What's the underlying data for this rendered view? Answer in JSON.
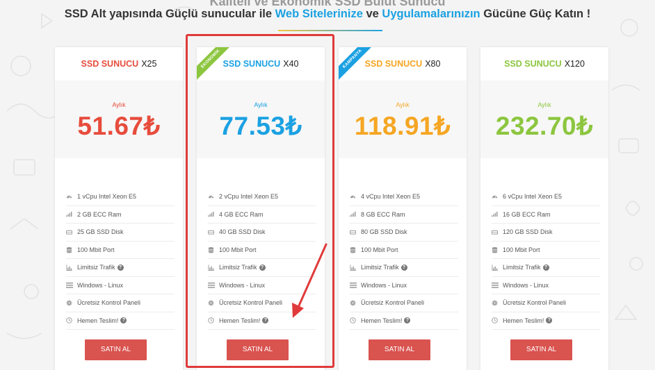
{
  "header": {
    "top_cut_text": "Kaliteli ve Ekonomik SSD Bulut Sunucu",
    "subtitle_part1": "SSD Alt yapısında Güçlü sunucular ile ",
    "subtitle_hl1": "Web Sitelerinize",
    "subtitle_part2": " ve ",
    "subtitle_hl2": "Uygulamalarınızın",
    "subtitle_part3": " Gücüne Güç Katın !"
  },
  "colors": {
    "red": "#e74c3c",
    "blue": "#1ba1e2",
    "orange": "#f5a623",
    "green": "#8cc63f",
    "button": "#d9534f",
    "highlight": "#e03a3a"
  },
  "cards": [
    {
      "brand": "SSD SUNUCU",
      "model": "X25",
      "period": "Aylık",
      "price": "51.67₺",
      "features": [
        "1 vCpu Intel Xeon E5",
        "2 GB ECC Ram",
        "25 GB SSD Disk",
        "100 Mbit Port",
        "Limitsiz Trafik",
        "Windows - Linux",
        "Ücretsiz Kontrol Paneli",
        "Hemen Teslim!"
      ],
      "button": "SATIN AL"
    },
    {
      "brand": "SSD SUNUCU",
      "model": "X40",
      "period": "Aylık",
      "price": "77.53₺",
      "ribbon": "EKONOMİK",
      "features": [
        "2 vCpu Intel Xeon E5",
        "4 GB ECC Ram",
        "40 GB SSD Disk",
        "100 Mbit Port",
        "Limitsiz Trafik",
        "Windows - Linux",
        "Ücretsiz Kontrol Paneli",
        "Hemen Teslim!"
      ],
      "button": "SATIN AL"
    },
    {
      "brand": "SSD SUNUCU",
      "model": "X80",
      "period": "Aylık",
      "price": "118.91₺",
      "ribbon": "KAMPANYA",
      "features": [
        "4 vCpu Intel Xeon E5",
        "8 GB ECC Ram",
        "80 GB SSD Disk",
        "100 Mbit Port",
        "Limitsiz Trafik",
        "Windows - Linux",
        "Ücretsiz Kontrol Paneli",
        "Hemen Teslim!"
      ],
      "button": "SATIN AL"
    },
    {
      "brand": "SSD SUNUCU",
      "model": "X120",
      "period": "Aylık",
      "price": "232.70₺",
      "features": [
        "6 vCpu Intel Xeon E5",
        "16 GB ECC Ram",
        "120 GB SSD Disk",
        "100 Mbit Port",
        "Limitsiz Trafik",
        "Windows - Linux",
        "Ücretsiz Kontrol Paneli",
        "Hemen Teslim!"
      ],
      "button": "SATIN AL"
    }
  ],
  "feature_icons": [
    "dashboard-icon",
    "signal-bars-icon",
    "hard-drive-icon",
    "database-icon",
    "bar-chart-icon",
    "menu-lines-icon",
    "gear-icon",
    "clock-icon"
  ]
}
